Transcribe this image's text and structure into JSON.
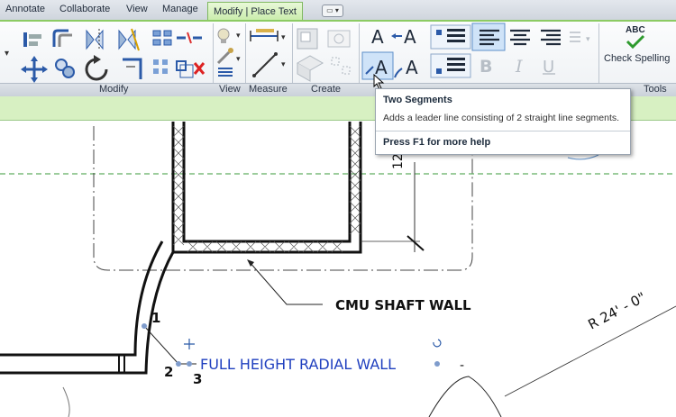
{
  "tabs": [
    "Annotate",
    "Collaborate",
    "View",
    "Manage"
  ],
  "active_tab": "Modify | Place Text",
  "tab_extra_glyph": "▭ ▾",
  "panels": {
    "modify": "Modify",
    "view": "View",
    "measure": "Measure",
    "create": "Create",
    "tools": "Tools"
  },
  "spelling": {
    "label": "Check Spelling",
    "abc": "ABC",
    "check": "✔"
  },
  "format_buttons": {
    "bold": "B",
    "italic": "I",
    "underline": "U",
    "text_a": "A"
  },
  "tooltip": {
    "title": "Two Segments",
    "description": "Adds a leader line consisting of 2 straight line segments.",
    "help": "Press F1 for more help"
  },
  "drawing": {
    "label_shaft": "CMU SHAFT WALL",
    "label_radial": "FULL HEIGHT RADIAL WALL",
    "radius": "R 24' - 0\"",
    "dim": "12",
    "points": [
      "1",
      "2",
      "3"
    ],
    "dash": "-"
  },
  "colors": {
    "ribbon_accent": "#8ccb63",
    "text_blue": "#1f3fbf",
    "grid_green": "#3a9a3a"
  }
}
